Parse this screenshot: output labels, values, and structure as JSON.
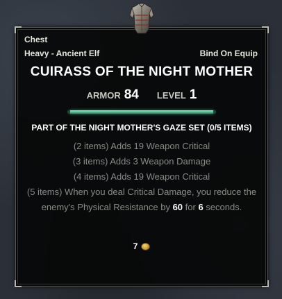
{
  "tooltip": {
    "slot": "Chest",
    "armor_type": "Heavy - Ancient Elf",
    "bind": "Bind On Equip",
    "name": "CUIRASS OF THE NIGHT MOTHER",
    "stats": {
      "armor_label": "ARMOR",
      "armor_value": "84",
      "level_label": "LEVEL",
      "level_value": "1"
    },
    "set": {
      "title": "PART OF THE NIGHT MOTHER'S GAZE SET (0/5 ITEMS)",
      "bonus_1": "(2 items) Adds 19 Weapon Critical",
      "bonus_2": "(3 items) Adds 3 Weapon Damage",
      "bonus_3": "(4 items) Adds 19 Weapon Critical",
      "bonus_5_part1": "(5 items) When you deal Critical Damage, you reduce the enemy's Physical Resistance by ",
      "bonus_5_value1": "60",
      "bonus_5_part2": " for ",
      "bonus_5_value2": "6",
      "bonus_5_part3": " seconds."
    },
    "value": "7",
    "icons": {
      "item": "cuirass-icon",
      "currency": "gold-coin-icon"
    },
    "colors": {
      "divider": "#4fbf94",
      "inactive_bonus": "#8a8a86",
      "text": "#ffffff"
    }
  }
}
